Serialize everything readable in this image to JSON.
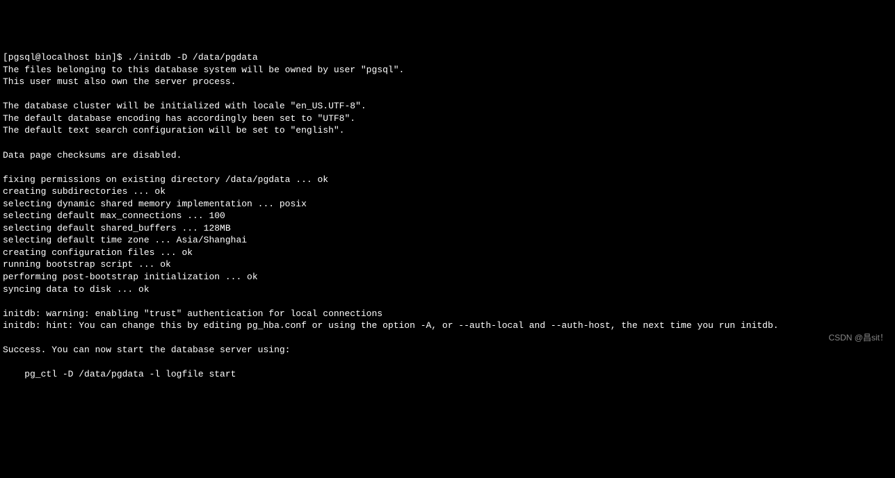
{
  "terminal": {
    "lines": [
      "[pgsql@localhost bin]$ ./initdb -D /data/pgdata",
      "The files belonging to this database system will be owned by user \"pgsql\".",
      "This user must also own the server process.",
      "",
      "The database cluster will be initialized with locale \"en_US.UTF-8\".",
      "The default database encoding has accordingly been set to \"UTF8\".",
      "The default text search configuration will be set to \"english\".",
      "",
      "Data page checksums are disabled.",
      "",
      "fixing permissions on existing directory /data/pgdata ... ok",
      "creating subdirectories ... ok",
      "selecting dynamic shared memory implementation ... posix",
      "selecting default max_connections ... 100",
      "selecting default shared_buffers ... 128MB",
      "selecting default time zone ... Asia/Shanghai",
      "creating configuration files ... ok",
      "running bootstrap script ... ok",
      "performing post-bootstrap initialization ... ok",
      "syncing data to disk ... ok",
      "",
      "initdb: warning: enabling \"trust\" authentication for local connections",
      "initdb: hint: You can change this by editing pg_hba.conf or using the option -A, or --auth-local and --auth-host, the next time you run initdb.",
      "",
      "Success. You can now start the database server using:",
      "",
      "    pg_ctl -D /data/pgdata -l logfile start",
      ""
    ]
  },
  "watermark": "CSDN @昌sit！"
}
